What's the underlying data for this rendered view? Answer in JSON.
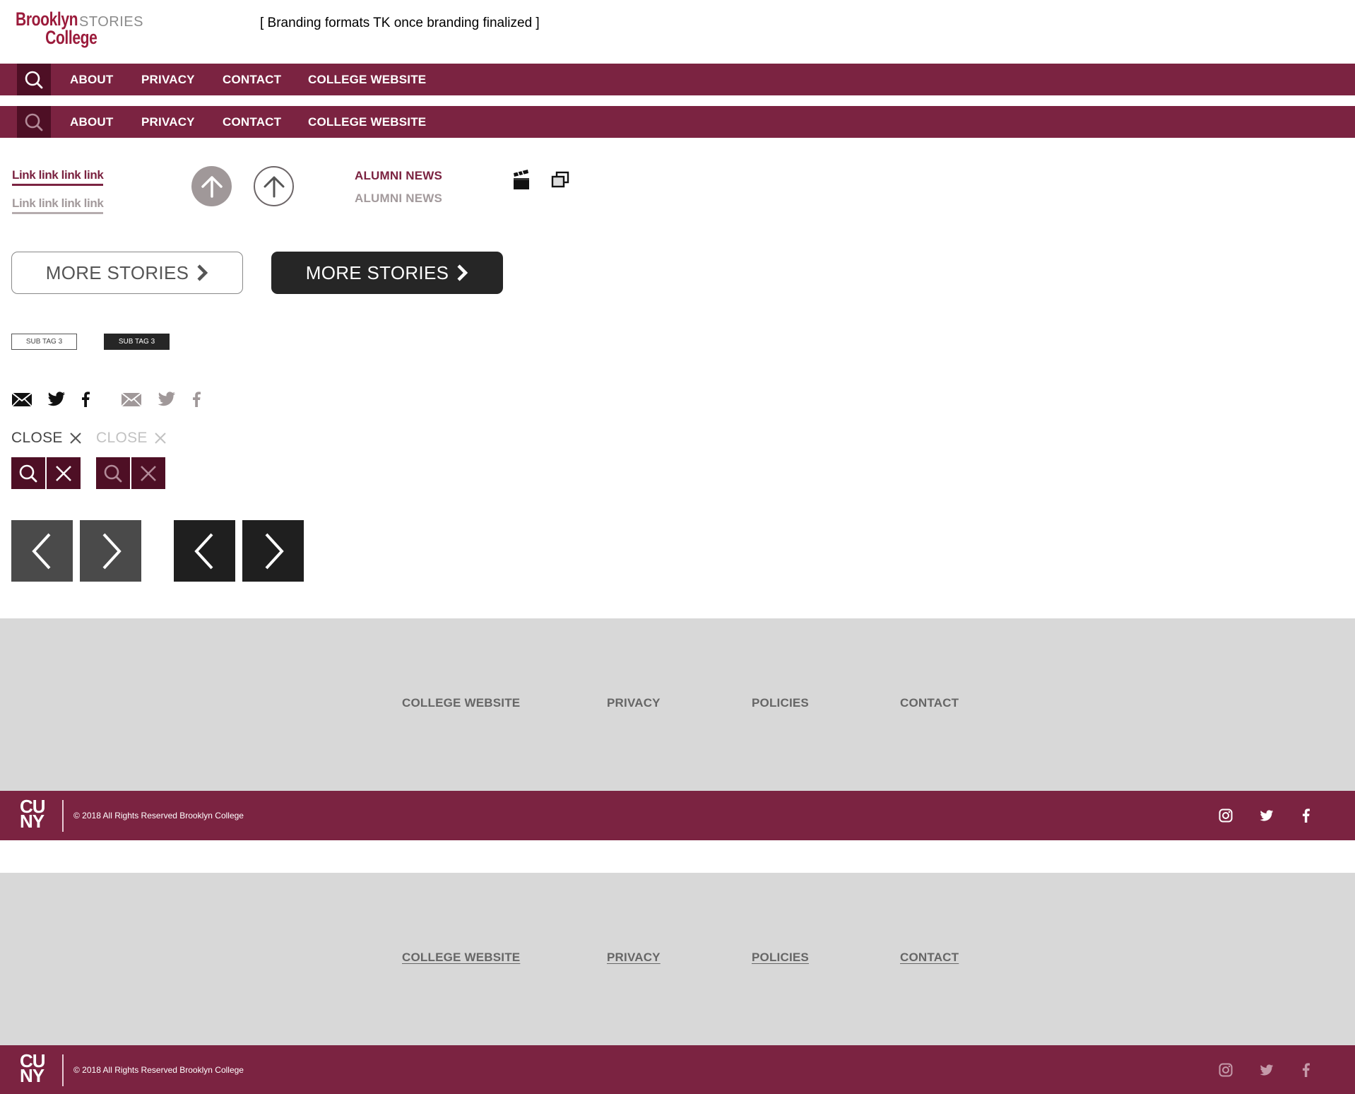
{
  "header": {
    "logo_line1": "Brooklyn",
    "logo_line2": "College",
    "logo_stories": "STORIES",
    "branding_note": "[ Branding formats TK once branding finalized ]"
  },
  "nav": {
    "items": [
      "ABOUT",
      "PRIVACY",
      "CONTACT",
      "COLLEGE WEBSITE"
    ]
  },
  "links": {
    "sample_dark": "Link link link link",
    "sample_grey": "Link link link link",
    "alumni_dark": "ALUMNI NEWS",
    "alumni_grey": "ALUMNI NEWS"
  },
  "buttons": {
    "more_stories_outline": "MORE STORIES",
    "more_stories_filled": "MORE STORIES",
    "subtag_outline": "SUB TAG 3",
    "subtag_filled": "SUB TAG 3",
    "close_dark": "CLOSE",
    "close_light": "CLOSE"
  },
  "footer": {
    "links": [
      "COLLEGE WEBSITE",
      "PRIVACY",
      "POLICIES",
      "CONTACT"
    ],
    "cuny_top": "CU",
    "cuny_bottom": "NY",
    "copyright": "© 2018 All Rights Reserved Brooklyn College"
  },
  "colors": {
    "brand": "#7b2341",
    "brand_dark": "#4e0f25",
    "footer_grey": "#d8d8d8",
    "button_dark": "#262626"
  }
}
